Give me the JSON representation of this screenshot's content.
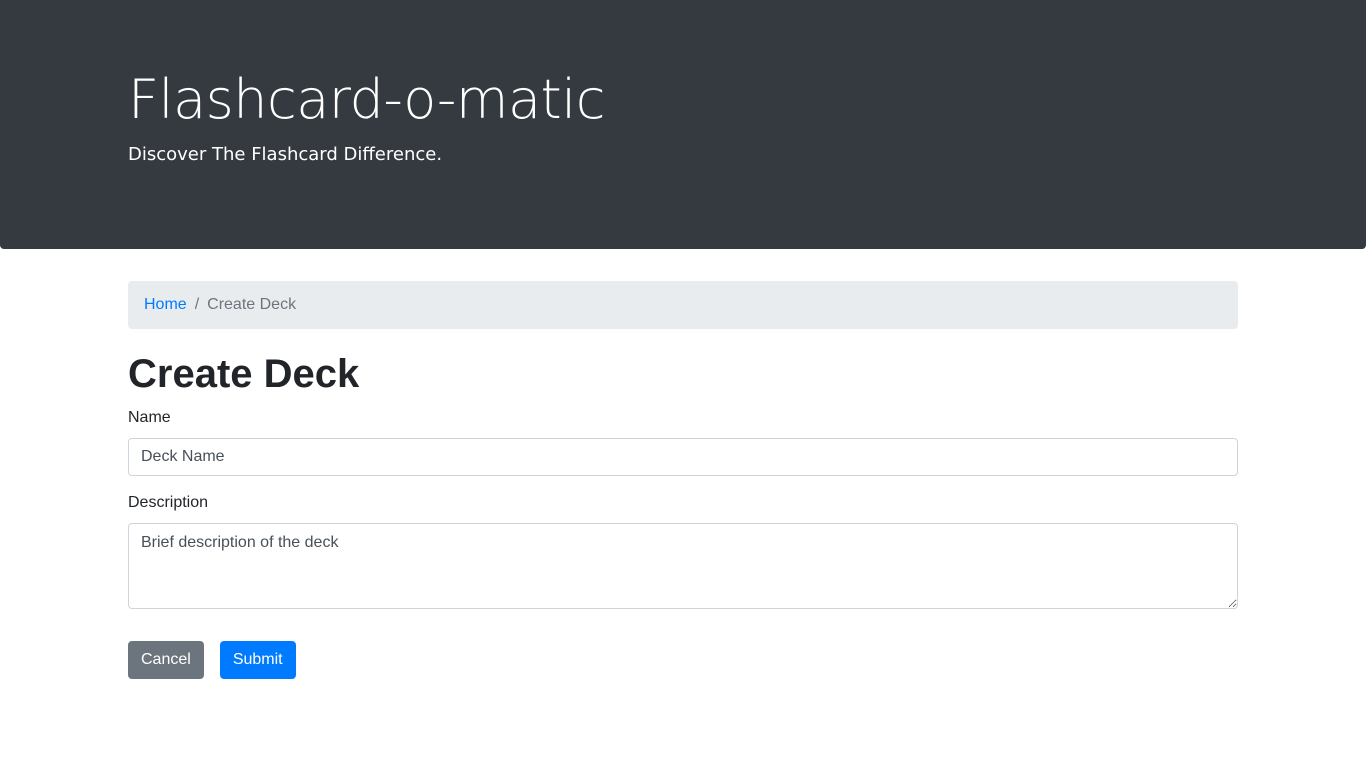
{
  "header": {
    "title": "Flashcard-o-matic",
    "tagline": "Discover The Flashcard Difference."
  },
  "breadcrumb": {
    "home": "Home",
    "separator": "/",
    "current": "Create Deck"
  },
  "page": {
    "title": "Create Deck"
  },
  "form": {
    "name_label": "Name",
    "name_placeholder": "Deck Name",
    "description_label": "Description",
    "description_placeholder": "Brief description of the deck",
    "cancel_label": "Cancel",
    "submit_label": "Submit"
  },
  "colors": {
    "header_bg": "#343a40",
    "breadcrumb_bg": "#e9ecef",
    "primary": "#007bff",
    "secondary": "#6c757d"
  }
}
